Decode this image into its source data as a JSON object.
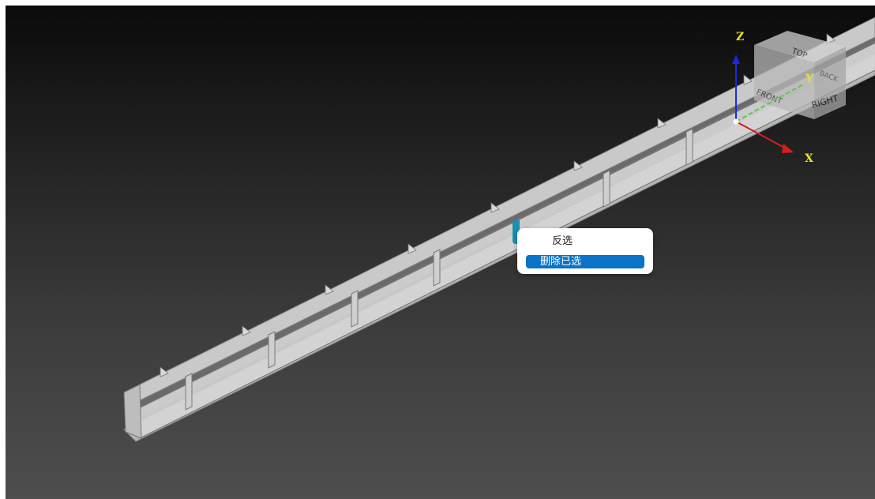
{
  "viewport": {
    "background_top": "#0b0b0b",
    "background_bottom": "#4e4e4e"
  },
  "axes": {
    "z_label": "Z",
    "y_label": "Y",
    "x_label": "X",
    "z_color": "#1a2bd6",
    "y_color": "#5ccc4a",
    "x_color": "#d41e1e",
    "label_color": "#f0e020"
  },
  "view_cube": {
    "top": "TOP",
    "right": "RIGHT",
    "front": "FRONT",
    "back": "BACK"
  },
  "context_menu": {
    "items": [
      {
        "label": "反选",
        "highlighted": false
      },
      {
        "label": "删除已选",
        "highlighted": true
      }
    ],
    "highlight_color": "#0a73c8"
  },
  "model": {
    "beam_color": "#c8c8c8"
  }
}
